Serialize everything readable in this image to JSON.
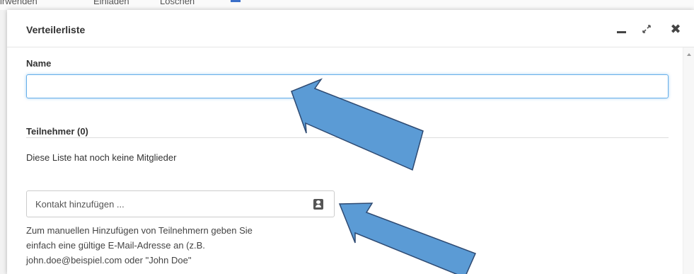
{
  "background_toolbar": {
    "items": [
      "irwenden",
      "Einladen",
      "Löschen"
    ]
  },
  "dialog": {
    "title": "Verteilerliste",
    "name_label": "Name",
    "name_value": "",
    "members_label": "Teilnehmer (0)",
    "empty_message": "Diese Liste hat noch keine Mitglieder",
    "contact_placeholder": "Kontakt hinzufügen ...",
    "help_lines": [
      "Zum manuellen Hinzufügen von Teilnehmern geben Sie",
      "einfach eine gültige E-Mail-Adresse an (z.B.",
      "john.doe@beispiel.com oder \"John Doe\""
    ]
  },
  "icons": {
    "minimize": "minimize-icon",
    "maximize": "maximize-icon",
    "close": "close-icon",
    "address_book": "address-book-icon"
  },
  "colors": {
    "focus_border": "#66afe9",
    "annotation_arrow": "#5b9bd5",
    "annotation_arrow_stroke": "#2e4a72"
  }
}
